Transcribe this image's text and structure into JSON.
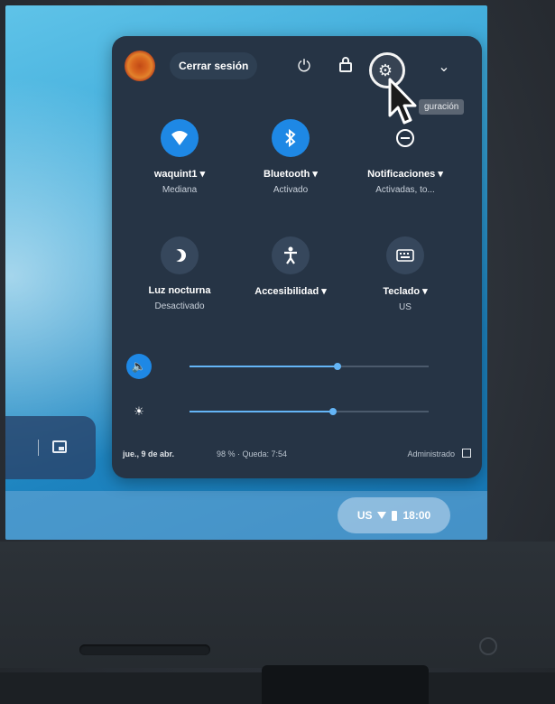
{
  "header": {
    "signout_label": "Cerrar sesión",
    "power_icon": "power-icon",
    "lock_icon": "lock-icon",
    "settings_icon": "gear-icon",
    "collapse_icon": "chevron-down-icon",
    "tooltip": "guración"
  },
  "tiles": [
    {
      "name": "waquint1 ▾",
      "sub": "Mediana",
      "icon": "wifi-icon",
      "state": "on"
    },
    {
      "name": "Bluetooth ▾",
      "sub": "Activado",
      "icon": "bluetooth-icon",
      "state": "on"
    },
    {
      "name": "Notificaciones ▾",
      "sub": "Activadas, to...",
      "icon": "do-not-disturb-icon",
      "state": "bare"
    },
    {
      "name": "Luz nocturna",
      "sub": "Desactivado",
      "icon": "night-light-icon",
      "state": "off"
    },
    {
      "name": "Accesibilidad ▾",
      "sub": "",
      "icon": "accessibility-icon",
      "state": "off"
    },
    {
      "name": "Teclado ▾",
      "sub": "US",
      "icon": "keyboard-icon",
      "state": "off"
    }
  ],
  "sliders": {
    "volume": {
      "icon": "volume-icon",
      "level": 0.62
    },
    "brightness": {
      "icon": "brightness-icon",
      "level": 0.6
    }
  },
  "footer": {
    "date": "jue., 9 de abr.",
    "battery": "98 % · Queda: 7:54",
    "managed": "Administrado"
  },
  "tray": {
    "input": "US",
    "time": "18:00"
  },
  "colors": {
    "panel_bg": "#263445",
    "accent": "#1e88e5",
    "wallpaper": "#3aa7d8"
  }
}
